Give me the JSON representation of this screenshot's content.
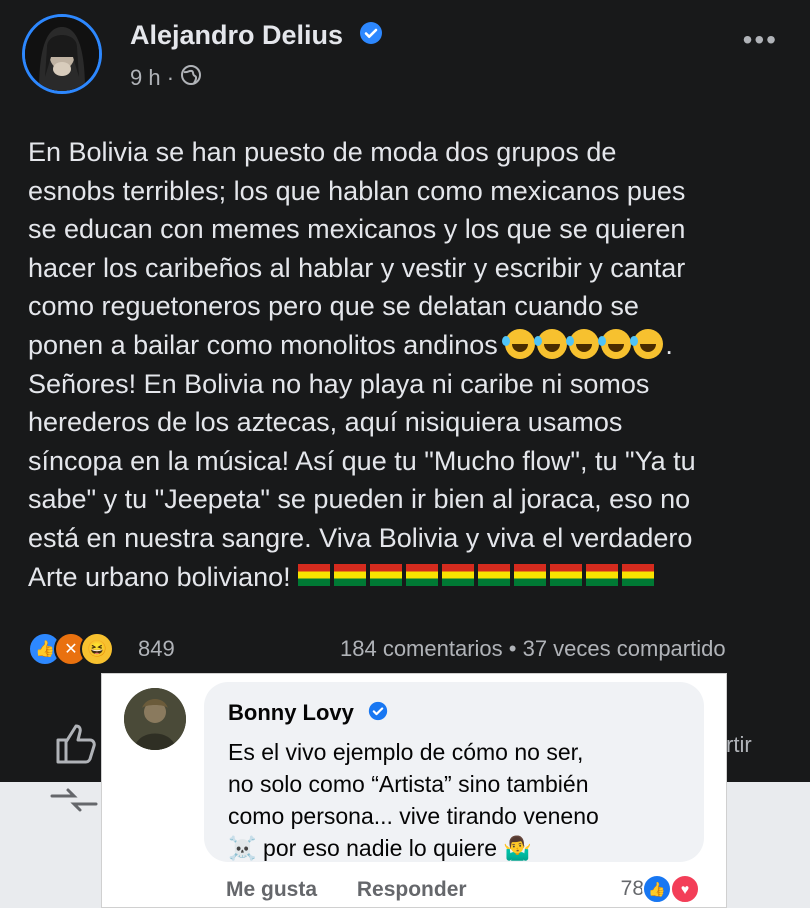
{
  "post": {
    "author": "Alejandro Delius",
    "time": "9 h ·",
    "text_lines": [
      "En Bolivia se han puesto de moda dos grupos de",
      "esnobs terribles; los que hablan como mexicanos pues",
      "se educan con memes mexicanos y los que se quieren",
      "hacer los caribeños al hablar y vestir y escribir y cantar",
      "como reguetoneros pero que se delatan cuando se",
      "ponen a bailar como monolitos andinos",
      "Señores! En Bolivia no hay playa ni caribe ni somos",
      "herederos de los aztecas, aquí nisiquiera usamos",
      "síncopa en la música! Así que tu \"Mucho flow\", tu \"Ya tu",
      "sabe\" y tu \"Jeepeta\" se pueden ir bien al joraca, eso no",
      "está en nuestra sangre. Viva Bolivia y viva el verdadero",
      "Arte urbano boliviano!"
    ],
    "line6_tail": ".",
    "emoji_count": 5,
    "flag_count": 10,
    "reaction_count": "849",
    "comments": "184 comentarios",
    "shares": "• 37 veces compartido",
    "share_partial": "rtir"
  },
  "comment": {
    "author": "Bonny Lovy",
    "text": "Es el vivo ejemplo de cómo no ser,\nno solo como “Artista” sino también\ncomo persona... vive tirando veneno\n☠️ por eso nadie lo quiere 🤷‍♂️",
    "like_label": "Me gusta",
    "reply_label": "Responder",
    "like_count": "78"
  },
  "colors": {
    "background": "#18191a",
    "verified": "#2d88ff",
    "comment_bg": "#ffffff",
    "bubble_bg": "#f0f2f5"
  }
}
